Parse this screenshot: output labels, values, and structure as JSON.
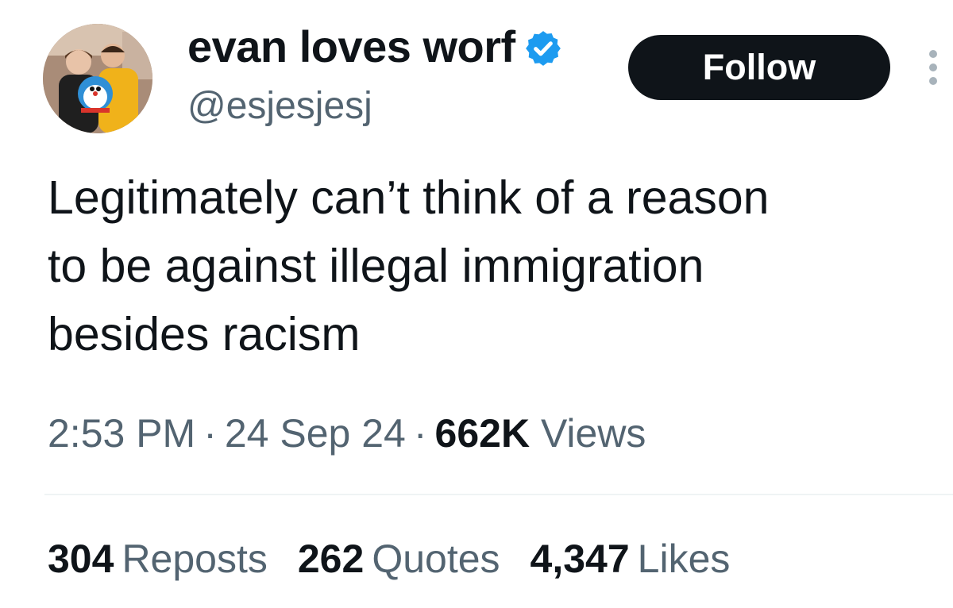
{
  "author": {
    "display_name": "evan loves worf",
    "handle": "@esjesjesj",
    "verified": true,
    "avatar_icon": "profile-photo-avatar",
    "verified_color": "#1d9bf0"
  },
  "actions": {
    "follow_label": "Follow",
    "more_icon": "more-vertical-icon"
  },
  "tweet": {
    "text": "Legitimately can’t think of a reason\nto be against illegal immigration\nbesides racism"
  },
  "meta": {
    "time": "2:53 PM",
    "separator": "·",
    "date": "24 Sep 24",
    "views_count": "662K",
    "views_label": "Views"
  },
  "stats": [
    {
      "count": "304",
      "label": "Reposts"
    },
    {
      "count": "262",
      "label": "Quotes"
    },
    {
      "count": "4,347",
      "label": "Likes"
    }
  ],
  "colors": {
    "text_primary": "#0f1419",
    "text_secondary": "#536471",
    "button_bg": "#0f1419",
    "divider": "#eff3f4"
  }
}
